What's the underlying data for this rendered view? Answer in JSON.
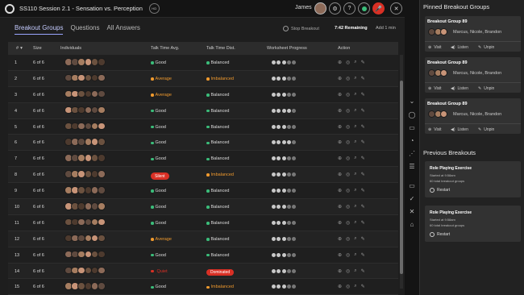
{
  "header": {
    "title": "SS110 Session 2.1 - Sensation vs. Perception",
    "course_badge": "HCI",
    "user_name": "James"
  },
  "tabs": [
    "Breakout Groups",
    "Questions",
    "All Answers"
  ],
  "controls": {
    "stop_label": "Stop Breakout",
    "time_remaining": "7:42 Remaining",
    "add_time": "Add 1 min"
  },
  "table": {
    "headers": {
      "num": "#",
      "size": "Size",
      "individuals": "Individuals",
      "talk_avg": "Talk Time Avg.",
      "talk_dist": "Talk Time Dist.",
      "progress": "Worksheet Progress",
      "action": "Action"
    },
    "rows": [
      {
        "num": "1",
        "size": "6 of 6",
        "avg": "Good",
        "dist": "Balanced",
        "progress": 3
      },
      {
        "num": "2",
        "size": "6 of 6",
        "avg": "Average",
        "dist": "Imbalanced",
        "progress": 3
      },
      {
        "num": "3",
        "size": "6 of 6",
        "avg": "Average",
        "dist": "Balanced",
        "progress": 3
      },
      {
        "num": "4",
        "size": "6 of 6",
        "avg": "Good",
        "dist": "Balanced",
        "progress": 4
      },
      {
        "num": "5",
        "size": "6 of 6",
        "avg": "Good",
        "dist": "Balanced",
        "progress": 3
      },
      {
        "num": "6",
        "size": "6 of 6",
        "avg": "Good",
        "dist": "Balanced",
        "progress": 4
      },
      {
        "num": "7",
        "size": "6 of 6",
        "avg": "Good",
        "dist": "Balanced",
        "progress": 3
      },
      {
        "num": "8",
        "size": "6 of 6",
        "avg": "Silent",
        "dist": "Imbalanced",
        "progress": 3
      },
      {
        "num": "9",
        "size": "6 of 6",
        "avg": "Good",
        "dist": "Balanced",
        "progress": 3
      },
      {
        "num": "10",
        "size": "6 of 6",
        "avg": "Good",
        "dist": "Balanced",
        "progress": 3
      },
      {
        "num": "11",
        "size": "6 of 6",
        "avg": "Good",
        "dist": "Balanced",
        "progress": 3
      },
      {
        "num": "12",
        "size": "6 of 6",
        "avg": "Average",
        "dist": "Balanced",
        "progress": 3
      },
      {
        "num": "13",
        "size": "6 of 6",
        "avg": "Good",
        "dist": "Balanced",
        "progress": 3
      },
      {
        "num": "14",
        "size": "6 of 6",
        "avg": "Quiet",
        "dist": "Dominated",
        "progress": 3
      },
      {
        "num": "15",
        "size": "6 of 6",
        "avg": "Good",
        "dist": "Imbalanced",
        "progress": 3
      }
    ]
  },
  "colors": {
    "good": "#3bbd7a",
    "average": "#f09a2e",
    "imbalanced": "#f09a2e",
    "balanced": "#3bbd7a",
    "alert": "#d93025",
    "accent": "#9aa6ff"
  },
  "pinned": {
    "title": "Pinned Breakout Groups",
    "cards": [
      {
        "title": "Breakout Group 89",
        "names": "Marcus, Nicole, Brandon"
      },
      {
        "title": "Breakout Group 89",
        "names": "Marcus, Nicole, Brandon"
      },
      {
        "title": "Breakout Group 89",
        "names": "Marcus, Nicole, Brandon"
      }
    ],
    "visit": "Visit",
    "listen": "Listen",
    "unpin": "Unpin"
  },
  "previous": {
    "title": "Previous Breakouts",
    "cards": [
      {
        "title": "Role Playing Exercise",
        "started": "Started at 9:58am",
        "groups": "60 total breakout groups",
        "restart": "Restart"
      },
      {
        "title": "Role Playing Exercise",
        "started": "Started at 9:58am",
        "groups": "60 total breakout groups",
        "restart": "Restart"
      }
    ]
  }
}
